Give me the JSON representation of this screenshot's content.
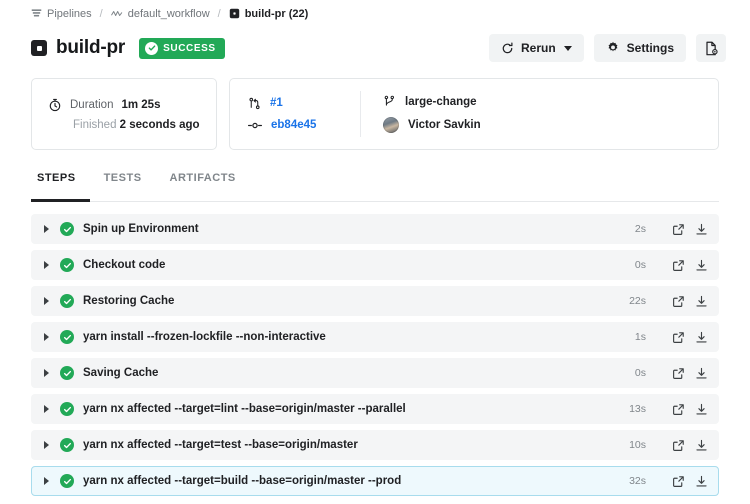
{
  "breadcrumb": {
    "pipelines_label": "Pipelines",
    "workflow_label": "default_workflow",
    "current_label": "build-pr (22)",
    "separator": "/"
  },
  "header": {
    "title": "build-pr",
    "status_badge": "SUCCESS",
    "status_color": "#22a957",
    "rerun_label": "Rerun",
    "settings_label": "Settings"
  },
  "info": {
    "duration_label": "Duration",
    "duration_value": "1m 25s",
    "finished_label": "Finished",
    "finished_value": "2 seconds ago",
    "pr_number": "#1",
    "commit_sha": "eb84e45",
    "branch": "large-change",
    "author": "Victor Savkin",
    "link_color": "#1a73e8"
  },
  "tabs": [
    {
      "label": "STEPS",
      "active": true
    },
    {
      "label": "TESTS",
      "active": false
    },
    {
      "label": "ARTIFACTS",
      "active": false
    }
  ],
  "steps": [
    {
      "label": "Spin up Environment",
      "duration": "2s",
      "status": "success",
      "selected": false
    },
    {
      "label": "Checkout code",
      "duration": "0s",
      "status": "success",
      "selected": false
    },
    {
      "label": "Restoring Cache",
      "duration": "22s",
      "status": "success",
      "selected": false
    },
    {
      "label": "yarn install --frozen-lockfile --non-interactive",
      "duration": "1s",
      "status": "success",
      "selected": false
    },
    {
      "label": "Saving Cache",
      "duration": "0s",
      "status": "success",
      "selected": false
    },
    {
      "label": "yarn nx affected --target=lint --base=origin/master --parallel",
      "duration": "13s",
      "status": "success",
      "selected": false
    },
    {
      "label": "yarn nx affected --target=test --base=origin/master",
      "duration": "10s",
      "status": "success",
      "selected": false
    },
    {
      "label": "yarn nx affected --target=build --base=origin/master --prod",
      "duration": "32s",
      "status": "success",
      "selected": true
    }
  ]
}
